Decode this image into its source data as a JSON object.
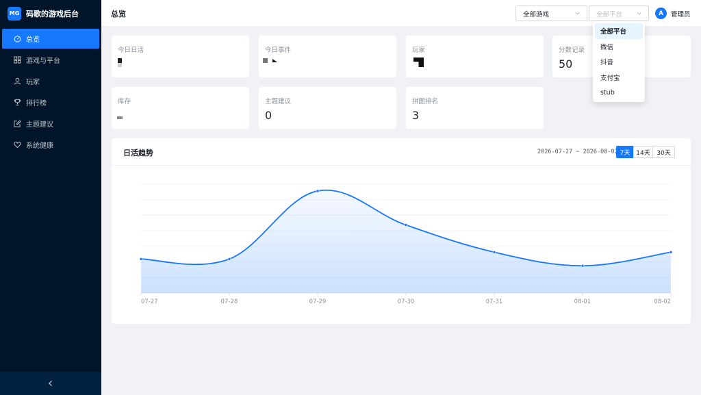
{
  "app": {
    "logo": "MG",
    "title": "码歌的游戏后台"
  },
  "sidebar": {
    "items": [
      {
        "label": "总览",
        "icon": "dashboard-icon",
        "active": true
      },
      {
        "label": "游戏与平台",
        "icon": "appstore-icon",
        "active": false
      },
      {
        "label": "玩家",
        "icon": "user-icon",
        "active": false
      },
      {
        "label": "排行榜",
        "icon": "trophy-icon",
        "active": false
      },
      {
        "label": "主题建议",
        "icon": "edit-icon",
        "active": false
      },
      {
        "label": "系统健康",
        "icon": "heart-icon",
        "active": false
      }
    ],
    "collapse_icon": "chevron-left-icon"
  },
  "header": {
    "title": "总览",
    "game_select": "全部游戏",
    "platform_select_placeholder": "全部平台",
    "user": {
      "avatar": "A",
      "name": "管理员"
    }
  },
  "platform_dropdown": {
    "options": [
      "全部平台",
      "微信",
      "抖音",
      "支付宝",
      "stub"
    ],
    "selected": "全部平台"
  },
  "stats": [
    {
      "label": "今日日活",
      "value": ""
    },
    {
      "label": "今日事件",
      "value": ""
    },
    {
      "label": "玩家",
      "value": ""
    },
    {
      "label": "分数记录",
      "value": "50"
    },
    {
      "label": "库存",
      "value": ""
    },
    {
      "label": "主题建议",
      "value": "0"
    },
    {
      "label": "拼图排名",
      "value": "3"
    }
  ],
  "trend": {
    "title": "日活趋势",
    "date_range": "2026-07-27 ~ 2026-08-02",
    "ranges": [
      "7天",
      "14天",
      "30天"
    ],
    "active_range": "7天"
  },
  "chart_data": {
    "type": "area",
    "title": "日活趋势",
    "categories": [
      "07-27",
      "07-28",
      "07-29",
      "07-30",
      "07-31",
      "08-01",
      "08-02"
    ],
    "values": [
      0.25,
      0.25,
      0.75,
      0.5,
      0.3,
      0.2,
      0.3
    ],
    "ylim": [
      0,
      0.8
    ],
    "grid": true,
    "color": "#1677ff"
  }
}
